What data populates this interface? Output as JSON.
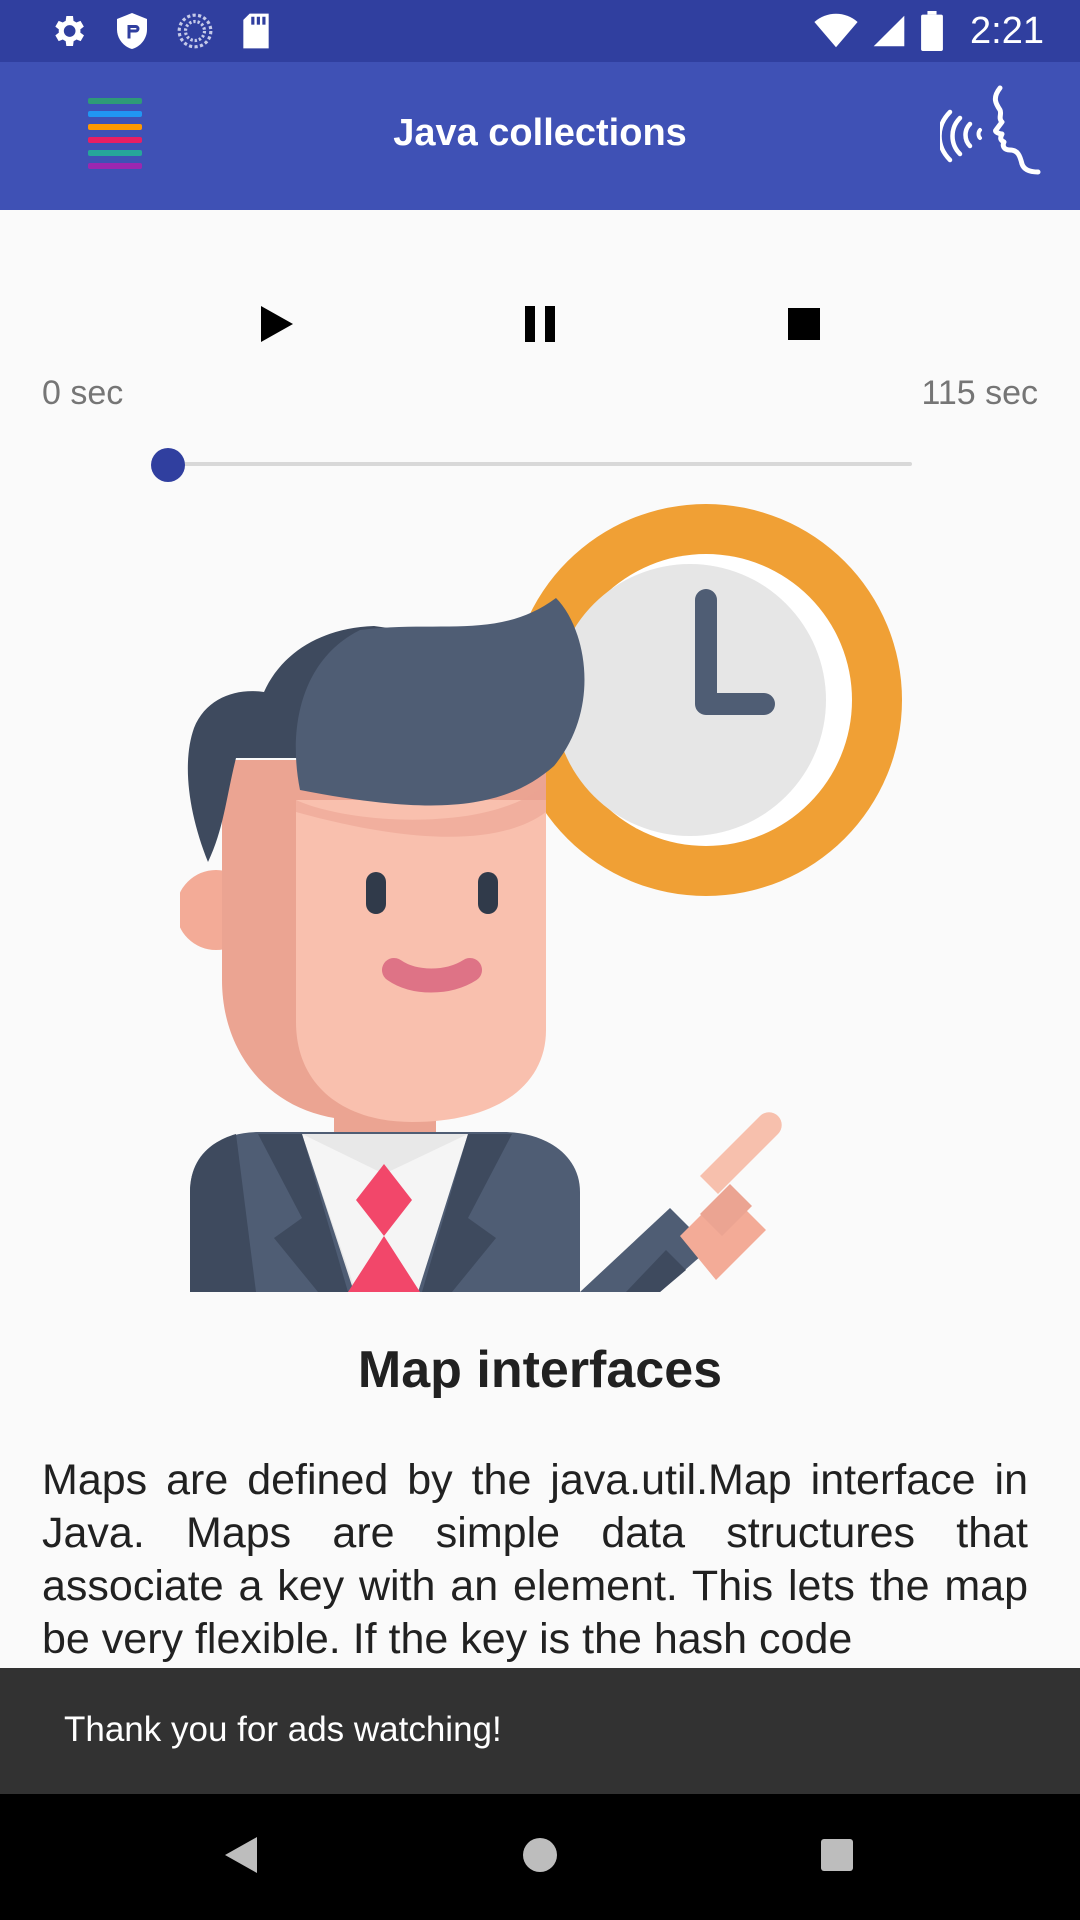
{
  "status_bar": {
    "time": "2:21",
    "icons_left": [
      "gear-icon",
      "shield-icon",
      "sync-icon",
      "sd-card-icon"
    ],
    "icons_right": [
      "wifi-icon",
      "signal-icon",
      "battery-icon"
    ]
  },
  "app_bar": {
    "title": "Java collections",
    "menu_icon": "multicolor-list-icon",
    "action_icon": "voice-speaking-icon",
    "menu_colors": [
      "#2e9a77",
      "#2196f3",
      "#ff9800",
      "#e91e63",
      "#26a69a",
      "#9c27b0"
    ]
  },
  "player": {
    "play_icon": "play-icon",
    "pause_icon": "pause-icon",
    "stop_icon": "stop-icon",
    "start_time": "0 sec",
    "end_time": "115 sec",
    "progress": 0
  },
  "content": {
    "illustration": "businessman-clock-illustration",
    "title": "Map interfaces",
    "body": "Maps are defined by the java.util.Map interface in Java. Maps are simple data structures that associate a key with an element. This lets the map be very flexible. If the key is the hash code"
  },
  "snackbar": {
    "message": "Thank you for ads watching!"
  },
  "nav_bar": {
    "back_icon": "back-icon",
    "home_icon": "home-icon",
    "recents_icon": "recents-icon"
  },
  "colors": {
    "status_bar": "#303f9f",
    "app_bar": "#3f51b5",
    "accent": "#303f9f",
    "clock_ring": "#f0a035"
  }
}
